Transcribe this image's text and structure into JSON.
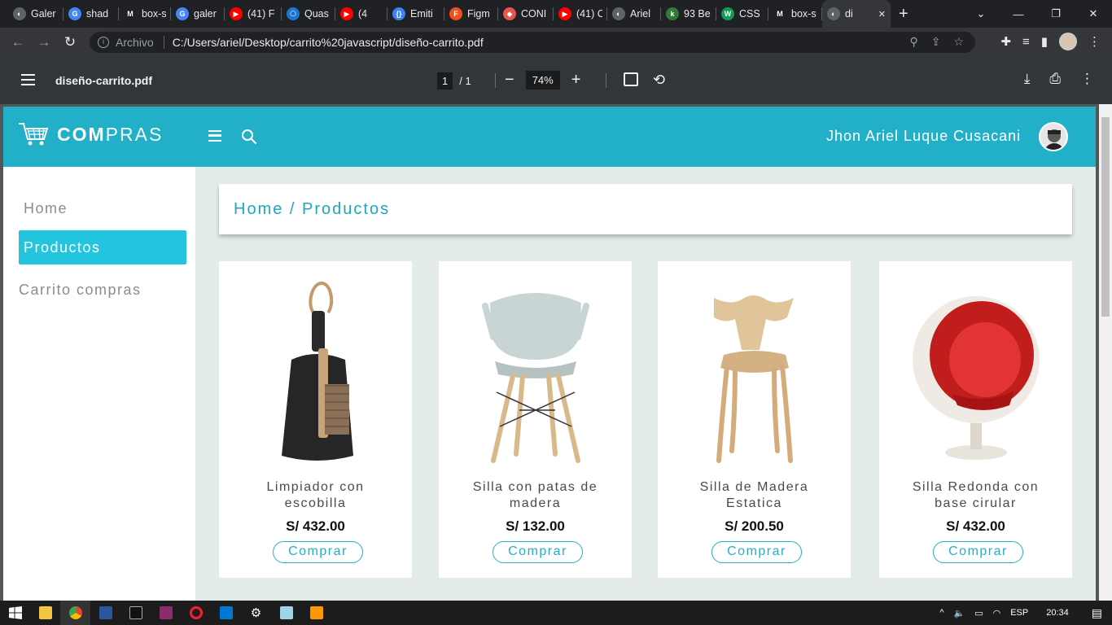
{
  "browser": {
    "tabs": [
      {
        "label": "Galer",
        "color": "#5f6368",
        "glyph": "◐"
      },
      {
        "label": "shad",
        "color": "#4285f4",
        "glyph": "G"
      },
      {
        "label": "box-s",
        "color": "#202124",
        "glyph": "M"
      },
      {
        "label": "galer",
        "color": "#4285f4",
        "glyph": "G"
      },
      {
        "label": "(41) F",
        "color": "#ff0000",
        "glyph": "▶"
      },
      {
        "label": "Quas",
        "color": "#1976d2",
        "glyph": "⎔"
      },
      {
        "label": "(4",
        "color": "#ff0000",
        "glyph": "▶"
      },
      {
        "label": "Emiti",
        "color": "#3b82f6",
        "glyph": "{}"
      },
      {
        "label": "Figm",
        "color": "#f24e1e",
        "glyph": "F"
      },
      {
        "label": "CONI",
        "color": "#e8554e",
        "glyph": "◆"
      },
      {
        "label": "(41) C",
        "color": "#ff0000",
        "glyph": "▶"
      },
      {
        "label": "Ariel",
        "color": "#5f6368",
        "glyph": "◐"
      },
      {
        "label": "93 Be",
        "color": "#2e7d32",
        "glyph": "k"
      },
      {
        "label": "CSS l",
        "color": "#0f9d58",
        "glyph": "W"
      },
      {
        "label": "box-s",
        "color": "#202124",
        "glyph": "M"
      },
      {
        "label": "di",
        "color": "#5f6368",
        "glyph": "◐",
        "active": true
      }
    ],
    "scheme": "Archivo",
    "url": "C:/Users/ariel/Desktop/carrito%20javascript/diseño-carrito.pdf"
  },
  "pdf": {
    "filename": "diseño-carrito.pdf",
    "page": "1",
    "total": "/  1",
    "zoom": "74%"
  },
  "app": {
    "logo_bold": "COM",
    "logo_light": "PRAS",
    "user": "Jhon Ariel Luque Cusacani",
    "breadcrumb": "Home / Productos",
    "sidebar": {
      "items": [
        {
          "label": "Home"
        },
        {
          "label": "Productos",
          "active": true
        },
        {
          "label": "Carrito compras"
        }
      ]
    },
    "products": [
      {
        "name": "Limpiador con escobilla",
        "price": "S/ 432.00",
        "button": "Comprar",
        "image": "dustpan-icon"
      },
      {
        "name": "Silla con patas de madera",
        "price": "S/ 132.00",
        "button": "Comprar",
        "image": "eames-chair-icon"
      },
      {
        "name": "Silla de Madera Estatica",
        "price": "S/ 200.50",
        "button": "Comprar",
        "image": "wooden-chair-icon"
      },
      {
        "name": "Silla Redonda con base cirular",
        "price": "S/ 432.00",
        "button": "Comprar",
        "image": "ball-chair-icon"
      }
    ]
  },
  "taskbar": {
    "lang": "ESP",
    "time": "20:34"
  }
}
